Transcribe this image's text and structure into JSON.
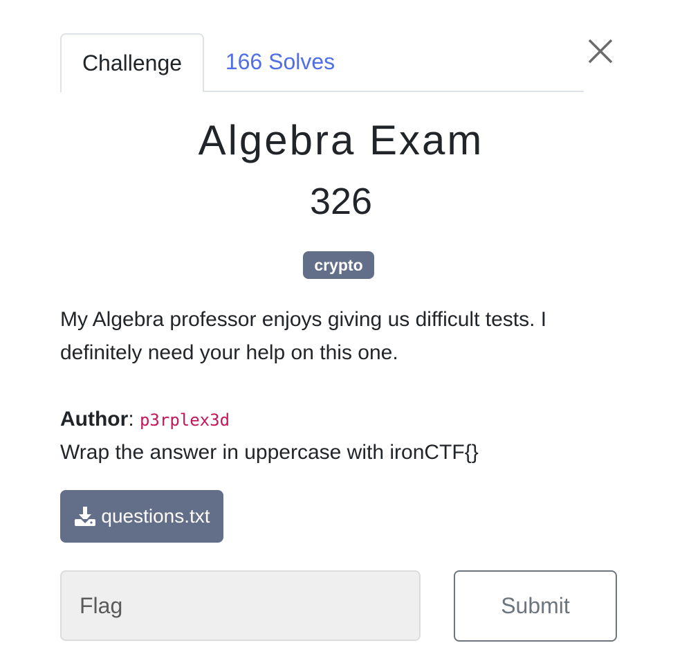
{
  "tabs": [
    {
      "label": "Challenge"
    },
    {
      "label": "166 Solves"
    }
  ],
  "challenge": {
    "name": "Algebra Exam",
    "value": "326",
    "tag": "crypto",
    "description": "My Algebra professor enjoys giving us difficult tests. I definitely need your help on this one.",
    "author_label": "Author",
    "author_name": "p3rplex3d",
    "wrap_note": "Wrap the answer in uppercase with ironCTF{}",
    "file": {
      "name": "questions.txt",
      "icon": "download-icon"
    }
  },
  "form": {
    "flag_placeholder": "Flag",
    "flag_value": "",
    "submit_label": "Submit"
  },
  "icons": {
    "close": "close-icon"
  },
  "colors": {
    "accent": "#636e89",
    "link": "#4f6ee8",
    "code": "#c2185b"
  }
}
